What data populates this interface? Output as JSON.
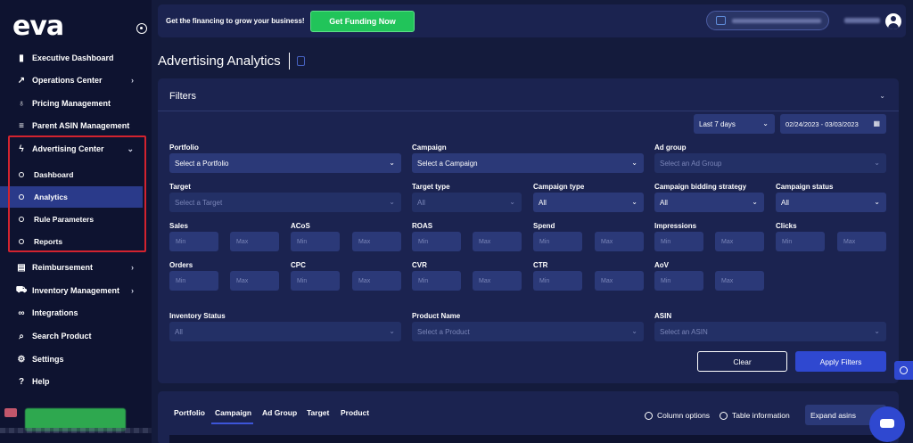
{
  "app": {
    "logo": "eva"
  },
  "sidebar": {
    "items": [
      {
        "label": "Executive Dashboard",
        "icon": "bar-chart-icon"
      },
      {
        "label": "Operations Center",
        "icon": "trending-up-icon",
        "expandable": true
      },
      {
        "label": "Pricing Management",
        "icon": "award-icon"
      },
      {
        "label": "Parent ASIN Management",
        "icon": "list-icon"
      },
      {
        "label": "Advertising Center",
        "icon": "lightning-icon",
        "expanded": true
      },
      {
        "label": "Reimbursement",
        "icon": "document-icon",
        "expandable": true
      },
      {
        "label": "Inventory Management",
        "icon": "truck-icon",
        "expandable": true
      },
      {
        "label": "Integrations",
        "icon": "link-icon"
      },
      {
        "label": "Search Product",
        "icon": "search-icon"
      },
      {
        "label": "Settings",
        "icon": "gear-icon"
      },
      {
        "label": "Help",
        "icon": "help-icon"
      }
    ],
    "advertising_sub": [
      {
        "label": "Dashboard"
      },
      {
        "label": "Analytics",
        "active": true
      },
      {
        "label": "Rule Parameters"
      },
      {
        "label": "Reports"
      }
    ],
    "chevron": "›",
    "chevron_down": "⌄"
  },
  "topbar": {
    "promo_text": "Get the financing to grow your business!",
    "cta_label": "Get Funding Now"
  },
  "page": {
    "title": "Advertising Analytics"
  },
  "filters": {
    "title": "Filters",
    "date_range": {
      "preset": "Last 7 days",
      "value": "02/24/2023 - 03/03/2023"
    },
    "portfolio": {
      "label": "Portfolio",
      "placeholder": "Select a Portfolio"
    },
    "campaign": {
      "label": "Campaign",
      "placeholder": "Select a Campaign"
    },
    "ad_group": {
      "label": "Ad group",
      "placeholder": "Select an Ad Group"
    },
    "target": {
      "label": "Target",
      "placeholder": "Select a Target"
    },
    "target_type": {
      "label": "Target type",
      "value": "All"
    },
    "campaign_type": {
      "label": "Campaign type",
      "value": "All"
    },
    "campaign_bidding_strategy": {
      "label": "Campaign bidding strategy",
      "value": "All"
    },
    "campaign_status": {
      "label": "Campaign status",
      "value": "All"
    },
    "ranges": {
      "sales": "Sales",
      "acos": "ACoS",
      "roas": "ROAS",
      "spend": "Spend",
      "impressions": "Impressions",
      "clicks": "Clicks",
      "orders": "Orders",
      "cpc": "CPC",
      "cvr": "CVR",
      "ctr": "CTR",
      "aov": "AoV",
      "min": "Min",
      "max": "Max"
    },
    "inventory_status": {
      "label": "Inventory Status",
      "value": "All"
    },
    "product_name": {
      "label": "Product Name",
      "placeholder": "Select a Product"
    },
    "asin": {
      "label": "ASIN",
      "placeholder": "Select an ASIN"
    },
    "clear_label": "Clear",
    "apply_label": "Apply Filters",
    "select_chevron": "⌄"
  },
  "results": {
    "tabs": [
      "Portfolio",
      "Campaign",
      "Ad Group",
      "Target",
      "Product"
    ],
    "active_tab": "Campaign",
    "column_options": "Column options",
    "table_information": "Table information",
    "expand_select": "Expand asins"
  }
}
